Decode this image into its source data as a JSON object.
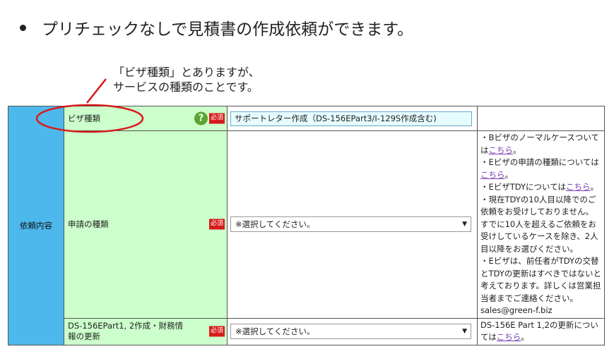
{
  "heading": "プリチェックなしで見積書の作成依頼ができます。",
  "callout": {
    "line1": "「ビザ種類」とありますが、",
    "line2": "サービスの種類のことです。"
  },
  "section_label": "依頼内容",
  "badges": {
    "help": "?",
    "required": "必須"
  },
  "rows": [
    {
      "label": "ビザ種類",
      "value": "サポートレター作成（DS-156EPart3/I-129S作成含む)"
    },
    {
      "label": "申請の種類",
      "value": "※選択してください。"
    },
    {
      "label": "DS-156EPart1, 2作成・財務情報の更新",
      "value": "※選択してください。"
    }
  ],
  "notes": {
    "n1_pre": "・Bビザのノーマルケースついては",
    "n1_link": "こちら",
    "n1_post": "。",
    "n2_pre": "・Eビザの申請の種類については",
    "n2_link": "こちら",
    "n2_post": "。",
    "n3_pre": "・EビザTDYについては",
    "n3_link": "こちら",
    "n3_post": "。",
    "n4": "・現在TDYの10人目以降でのご依頼をお受けしておりません。すでに10人を超えるご依頼をお受けしているケースを除き、2人目以降をお選びください。",
    "n5": "・Eビザは、前任者がTDYの交替とTDYの更新はすべきではないと考えております。詳しくは営業担当者までご連絡ください。",
    "email": "sales@green-f.biz",
    "n6_pre": "DS-156E Part 1,2の更新については",
    "n6_link": "こちら",
    "n6_post": "。"
  }
}
